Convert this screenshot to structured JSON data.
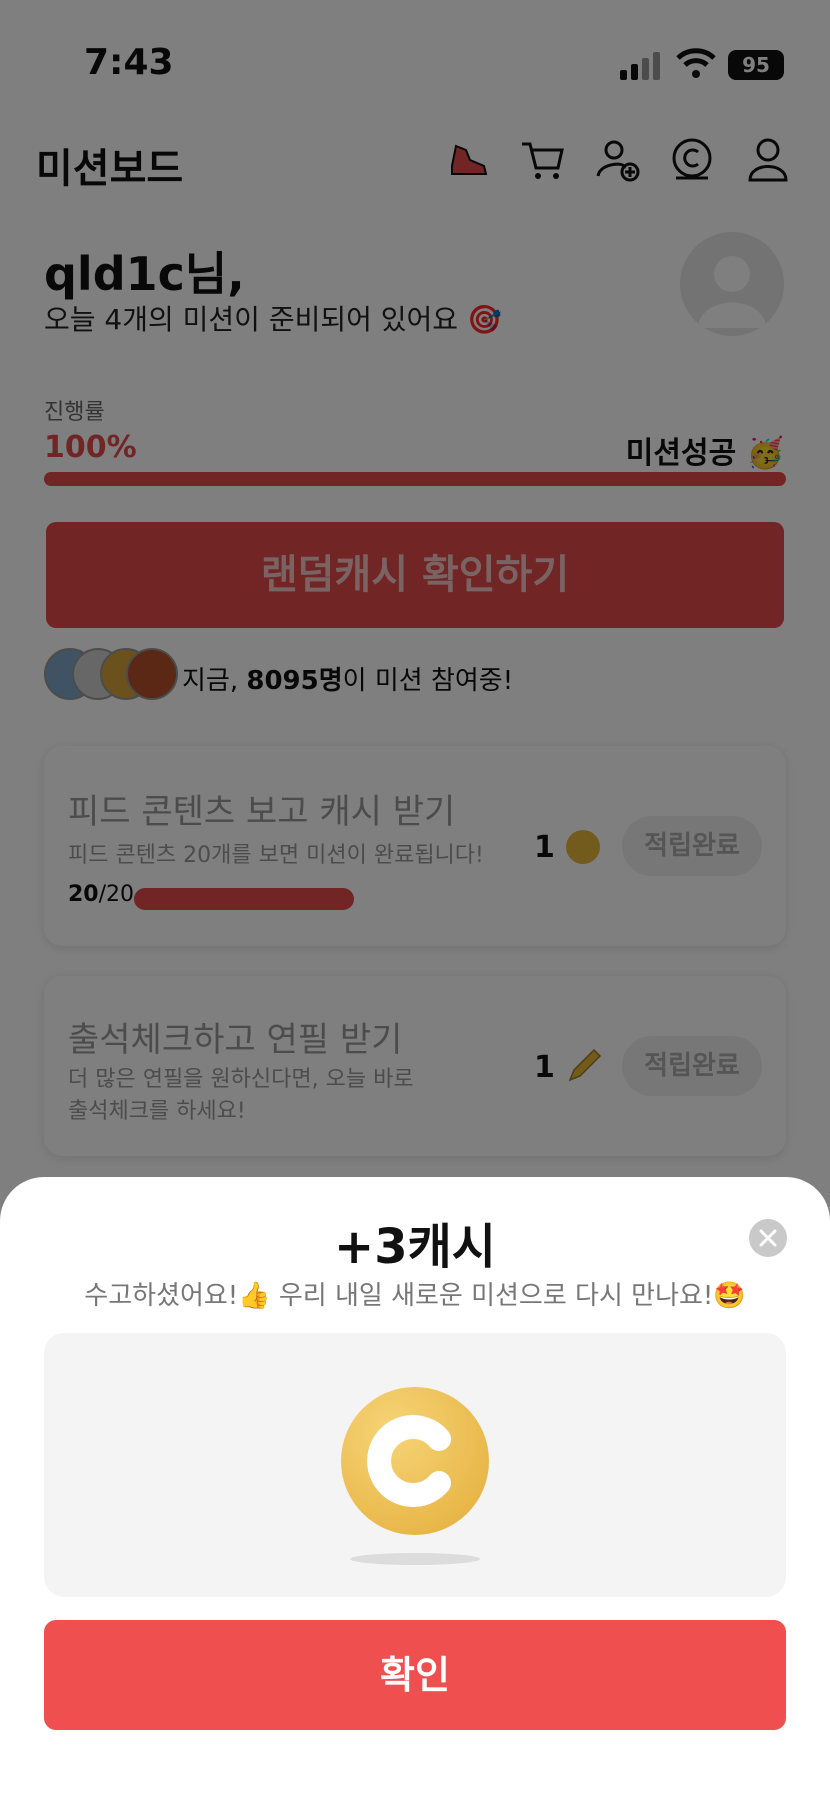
{
  "status_bar": {
    "time": "7:43",
    "battery": "95"
  },
  "header": {
    "title": "미션보드",
    "icons": [
      "shoe-icon",
      "cart-icon",
      "add-user-icon",
      "coin-icon",
      "profile-icon"
    ]
  },
  "greeting": {
    "name": "qld1c님,",
    "subtitle": "오늘 4개의 미션이 준비되어 있어요 🎯"
  },
  "progress": {
    "label": "진행률",
    "value": "100%",
    "fraction": 1.0,
    "status": "미션성공 🥳"
  },
  "random_cash": {
    "label": "랜덤캐시 확인하기"
  },
  "participants": {
    "prefix": "지금, ",
    "count": "8095명",
    "suffix": "이 미션 참여중!"
  },
  "missions": [
    {
      "title": "피드 콘텐츠 보고 캐시 받기",
      "desc": "피드 콘텐츠 20개를 보면 미션이 완료됩니다!",
      "progress_done": "20",
      "progress_total": "/20",
      "reward": "1",
      "reward_icon": "coin-icon",
      "button": "적립완료"
    },
    {
      "title": "출석체크하고 연필 받기",
      "desc_line1": "더 많은 연필을 원하신다면, 오늘 바로",
      "desc_line2": "출석체크를 하세요!",
      "reward": "1",
      "reward_icon": "pencil-icon",
      "button": "적립완료"
    }
  ],
  "sheet": {
    "title": "+3캐시",
    "subtitle": "수고하셨어요!👍 우리 내일 새로운 미션으로 다시 만나요!🤩",
    "confirm": "확인"
  },
  "colors": {
    "accent": "#e34b4b",
    "confirm": "#ef4f4f",
    "coin": "#e3ad39"
  }
}
